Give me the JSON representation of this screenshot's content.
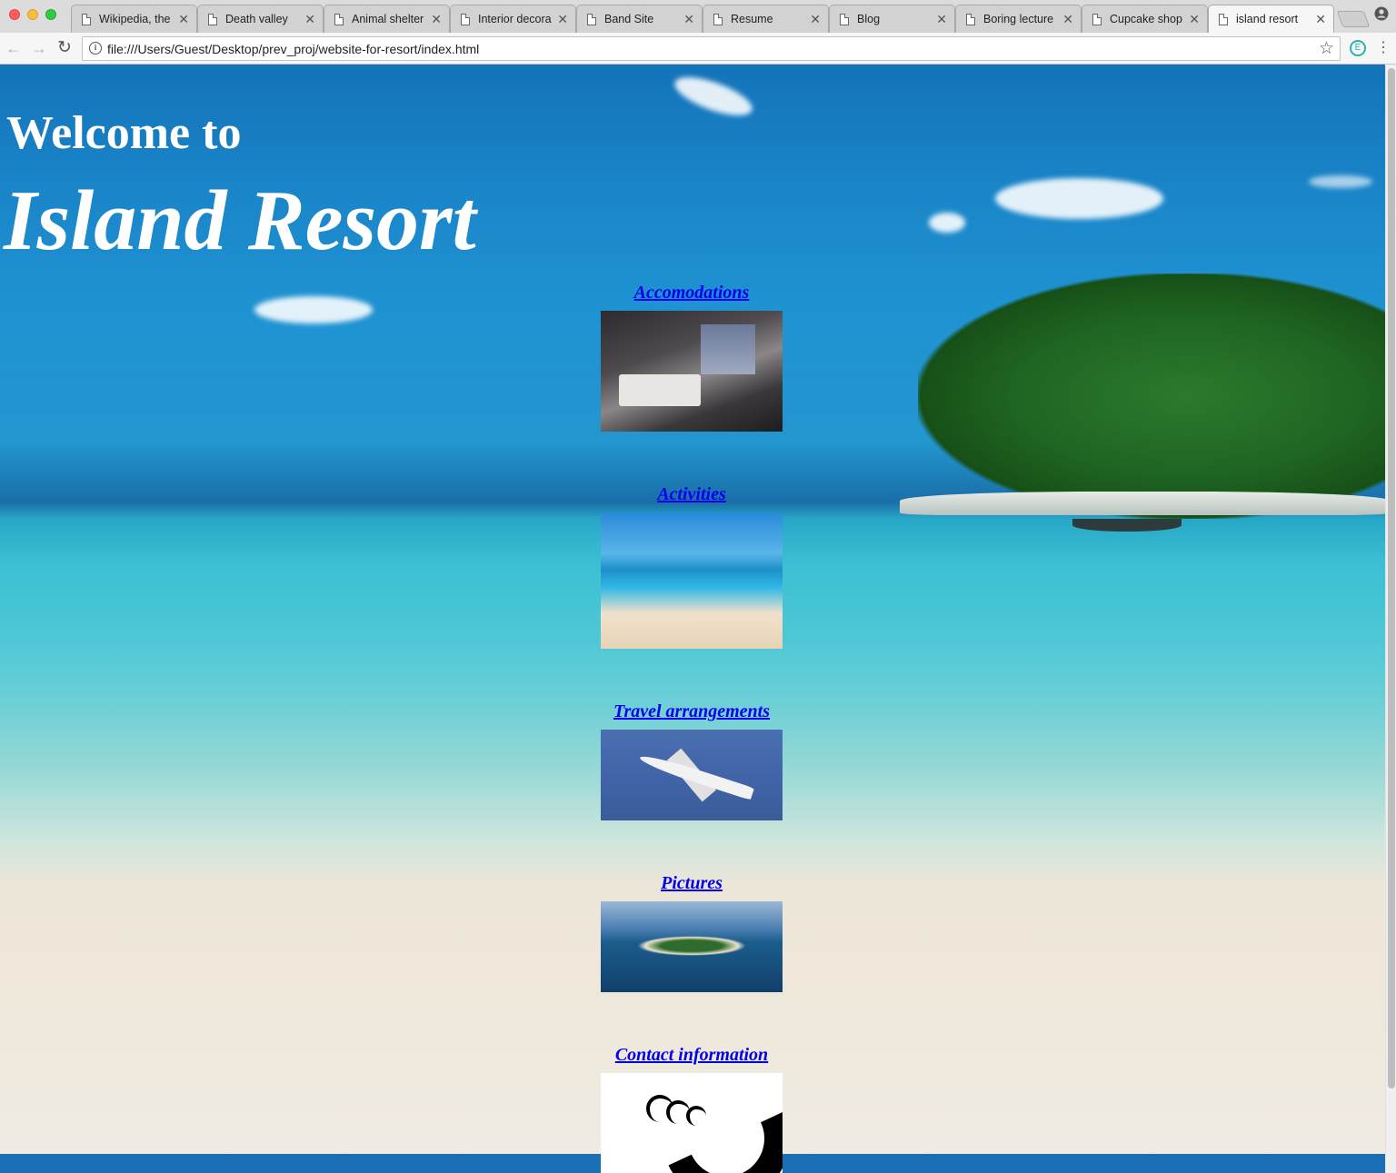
{
  "browser": {
    "tabs": [
      {
        "title": "Wikipedia, the",
        "active": false
      },
      {
        "title": "Death valley",
        "active": false
      },
      {
        "title": "Animal shelter",
        "active": false
      },
      {
        "title": "Interior decora",
        "active": false
      },
      {
        "title": "Band Site",
        "active": false
      },
      {
        "title": "Resume",
        "active": false
      },
      {
        "title": "Blog",
        "active": false
      },
      {
        "title": "Boring lecture",
        "active": false
      },
      {
        "title": "Cupcake shop",
        "active": false
      },
      {
        "title": "island resort",
        "active": true
      }
    ],
    "close_glyph": "✕",
    "url": "file:///Users/Guest/Desktop/prev_proj/website-for-resort/index.html",
    "extension_letter": "E",
    "icons": {
      "back": "arrow-left-icon",
      "forward": "arrow-right-icon",
      "reload": "reload-icon",
      "info": "info-icon",
      "bookmark": "star-icon",
      "menu": "kebab-menu-icon",
      "profile": "profile-icon"
    }
  },
  "page": {
    "welcome": "Welcome to",
    "resort_name": "Island Resort",
    "sections": [
      {
        "link": "Accomodations",
        "image": "hotel-room-image"
      },
      {
        "link": "Activities",
        "image": "pool-image"
      },
      {
        "link": "Travel arrangements",
        "image": "airplane-image"
      },
      {
        "link": "Pictures",
        "image": "island-aerial-image"
      },
      {
        "link": "Contact information",
        "image": "phone-image"
      }
    ],
    "colors": {
      "link": "#0000ee",
      "heading": "#ffffff",
      "footer_band": "#1a6eb4"
    }
  }
}
